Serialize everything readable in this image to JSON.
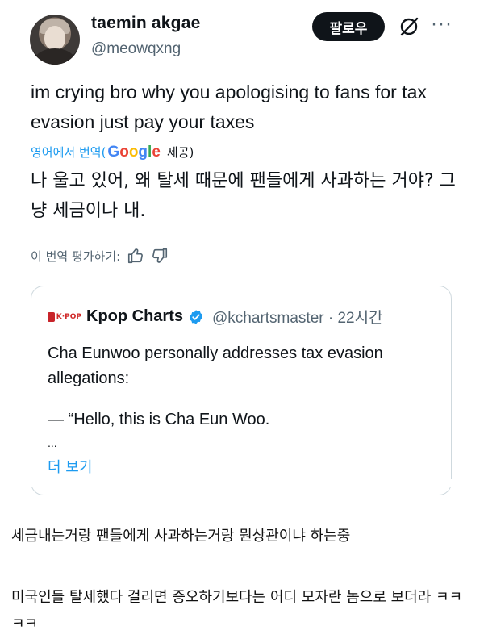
{
  "tweet": {
    "display_name": "taemin akgae",
    "handle": "@meowqxng",
    "follow_label": "팔로우",
    "more_label": "···",
    "text": "im crying bro why you apologising to fans for tax evasion just pay your taxes",
    "translated_from": "영어에서 번역(",
    "translator": "Google",
    "translator_suffix": "제공)",
    "translation": "나 울고 있어, 왜 탈세 때문에 팬들에게 사과하는 거야? 그냥 세금이나 내.",
    "rate_label": "이 번역 평가하기:"
  },
  "quote": {
    "name": "Kpop Charts",
    "handle": "@kchartsmaster · 22시간",
    "text": "Cha Eunwoo personally addresses tax evasion allegations:",
    "line2": "— “Hello, this is Cha Eun Woo.",
    "ellipsis": "...",
    "more_label": "더 보기"
  },
  "post": {
    "comment1": "세금내는거랑 팬들에게 사과하는거랑 뭔상관이냐 하는중",
    "comment2": "미국인들 탈세했다 걸리면 증오하기보다는 어디 모자란 놈으로 보더라 ㅋㅋㅋㅋ"
  },
  "colors": {
    "link": "#1d9bf0",
    "secondary_text": "#536471",
    "follow_bg": "#0f1419",
    "border": "#cfd9de"
  },
  "icons": [
    "grok-icon",
    "more-icon",
    "thumbs-up-icon",
    "thumbs-down-icon",
    "verified-badge-icon",
    "kpop-charts-logo"
  ]
}
